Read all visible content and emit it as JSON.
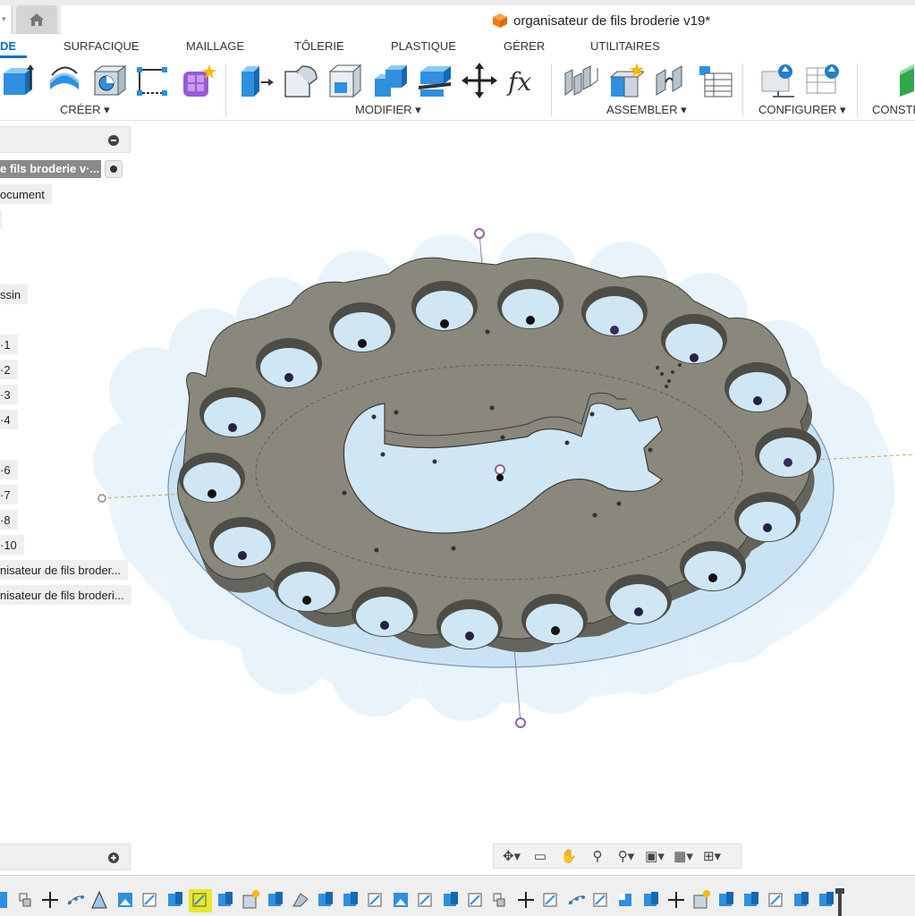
{
  "app": {
    "document_title": "organisateur de fils broderie v19*"
  },
  "workspace_tabs": [
    {
      "label": "DE",
      "active": true
    },
    {
      "label": "SURFACIQUE",
      "active": false
    },
    {
      "label": "MAILLAGE",
      "active": false
    },
    {
      "label": "TÔLERIE",
      "active": false
    },
    {
      "label": "PLASTIQUE",
      "active": false
    },
    {
      "label": "GÉRER",
      "active": false
    },
    {
      "label": "UTILITAIRES",
      "active": false
    }
  ],
  "toolbar": {
    "groups": [
      {
        "label": "CRÉER ▾",
        "icons": [
          "extrude-icon",
          "revolve-icon",
          "hole-icon",
          "sketch-pattern-icon",
          "create-form-icon"
        ]
      },
      {
        "label": "MODIFIER ▾",
        "icons": [
          "press-pull-icon",
          "fillet-icon",
          "shell-icon",
          "combine-icon",
          "split-body-icon",
          "move-icon",
          "parameters-fx-icon"
        ]
      },
      {
        "label": "ASSEMBLER ▾",
        "icons": [
          "joint-icon",
          "new-component-icon",
          "as-built-joint-icon",
          "table-icon"
        ]
      },
      {
        "label": "CONFIGURER ▾",
        "icons": [
          "configure-icon",
          "configure-table-icon"
        ]
      },
      {
        "label": "CONSTR",
        "icons": [
          "construct-plane-icon"
        ]
      }
    ]
  },
  "browser": {
    "root_label": "e fils broderie v·...",
    "nodes": [
      "ocument",
      "",
      "ssin",
      "·1",
      "·2",
      "·3",
      "·4",
      "·6",
      "·7",
      "·8",
      "·10",
      "nisateur de fils broder...",
      "nisateur de fils broderi..."
    ]
  },
  "navbar": {
    "icons": [
      "orbit-icon",
      "look-at-icon",
      "pan-hand-icon",
      "zoom-icon",
      "fit-zoom-icon",
      "display-settings-icon",
      "grid-icon",
      "viewports-icon"
    ]
  },
  "timeline": {
    "highlight_index": 8
  },
  "colors": {
    "accent": "#0a6fc2",
    "body_gray": "#868477",
    "sketch_fill": "#cfe6f5",
    "highlight": "#e8e82a"
  }
}
